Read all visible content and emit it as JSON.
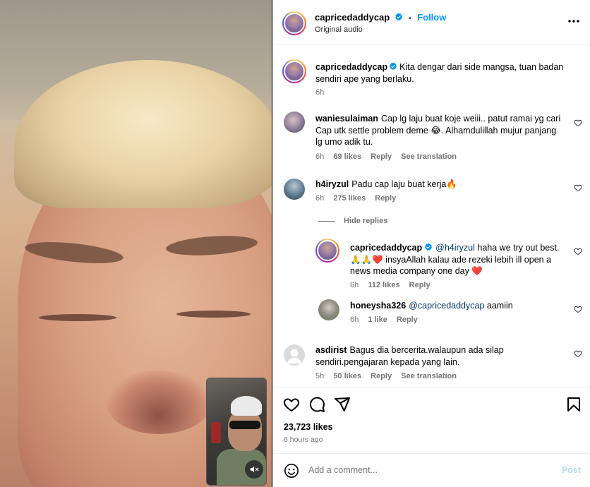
{
  "post": {
    "username": "capricedaddycap",
    "follow_label": "Follow",
    "separator": "•",
    "audio": "Original audio",
    "more": "•••",
    "caption": "Kita dengar dari side mangsa, tuan badan sendiri ape yang berlaku.",
    "caption_time": "6h"
  },
  "comments": [
    {
      "username": "waniesulaiman",
      "text": "Cap lg laju buat koje weiii.. patut ramai yg cari Cap utk settle problem deme 😂. Alhamdulillah mujur panjang lg umo adik tu.",
      "time": "6h",
      "likes": "69 likes",
      "reply": "Reply",
      "translate": "See translation"
    },
    {
      "username": "h4iryzul",
      "text": "Padu cap laju buat kerja🔥",
      "time": "6h",
      "likes": "275 likes",
      "reply": "Reply",
      "hide_replies": "Hide replies",
      "replies": [
        {
          "username": "capricedaddycap",
          "mention": "@h4iryzul",
          "text": "haha we try out best. 🙏🙏❤️ insyaAllah kalau ade rezeki lebih ill open a news media company one day ❤️",
          "time": "6h",
          "likes": "112 likes",
          "reply": "Reply"
        },
        {
          "username": "honeysha326",
          "mention": "@capricedaddycap",
          "text": "aamiin",
          "time": "6h",
          "likes": "1 like",
          "reply": "Reply"
        }
      ]
    },
    {
      "username": "asdirist",
      "text": "Bagus dia bercerita.walaupun ada silap sendiri.pengajaran kepada yang lain.",
      "time": "5h",
      "likes": "50 likes",
      "reply": "Reply",
      "translate": "See translation"
    }
  ],
  "actions": {
    "like_count": "23,723 likes",
    "posted_ago": "6 hours ago"
  },
  "composer": {
    "placeholder": "Add a comment...",
    "post_label": "Post"
  },
  "colors": {
    "accent": "#0095f6",
    "verified": "#0095f6",
    "muted": "#737373",
    "post_disabled": "#b3dbff"
  },
  "icons": [
    "verified-badge-icon",
    "more-options-icon",
    "heart-icon",
    "comment-icon",
    "share-icon",
    "bookmark-icon",
    "emoji-icon",
    "mute-icon"
  ]
}
